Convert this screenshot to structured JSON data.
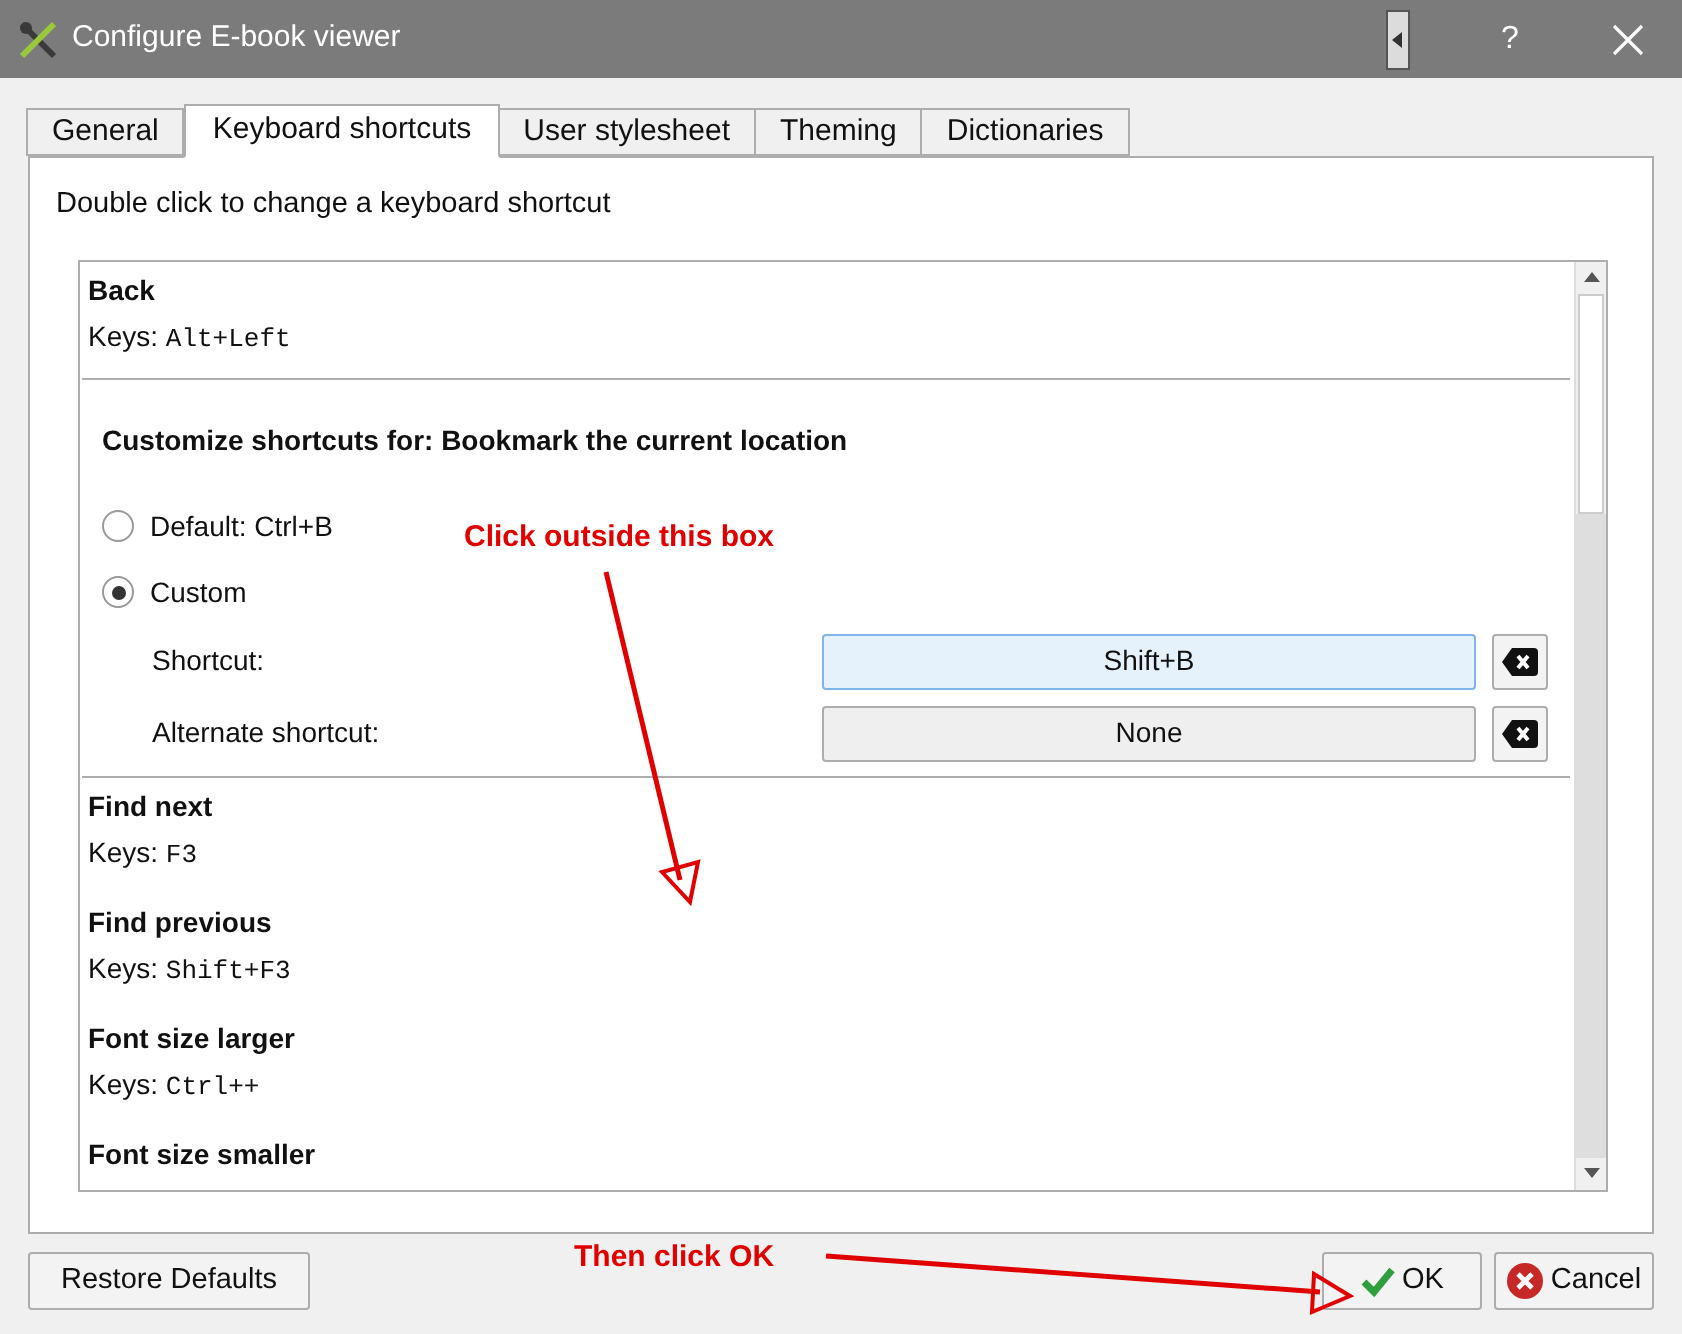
{
  "window": {
    "title": "Configure E-book viewer",
    "help": "?"
  },
  "tabs": [
    {
      "label": "General",
      "selected": false
    },
    {
      "label": "Keyboard shortcuts",
      "selected": true
    },
    {
      "label": "User stylesheet",
      "selected": false
    },
    {
      "label": "Theming",
      "selected": false
    },
    {
      "label": "Dictionaries",
      "selected": false
    }
  ],
  "hint": "Double click to change a keyboard shortcut",
  "shortcuts": [
    {
      "kind": "action",
      "name": "Back",
      "keys_label": "Keys:",
      "keys": "Alt+Left"
    },
    {
      "kind": "editor",
      "heading": "Customize shortcuts for: Bookmark the current location",
      "options": [
        {
          "label": "Default: Ctrl+B",
          "selected": false
        },
        {
          "label": "Custom",
          "selected": true
        }
      ],
      "fields": [
        {
          "label": "Shortcut:",
          "value": "Shift+B",
          "focused": true
        },
        {
          "label": "Alternate shortcut:",
          "value": "None",
          "focused": false
        }
      ]
    },
    {
      "kind": "action",
      "name": "Find next",
      "keys_label": "Keys:",
      "keys": "F3"
    },
    {
      "kind": "action",
      "name": "Find previous",
      "keys_label": "Keys:",
      "keys": "Shift+F3"
    },
    {
      "kind": "action",
      "name": "Font size larger",
      "keys_label": "Keys:",
      "keys": "Ctrl++"
    },
    {
      "kind": "action",
      "name": "Font size smaller"
    }
  ],
  "buttons": [
    {
      "kind": "restore",
      "label": "Restore Defaults"
    },
    {
      "kind": "ok",
      "label": "OK"
    },
    {
      "kind": "cancel",
      "label": "Cancel"
    }
  ],
  "annotations": [
    {
      "text": "Click outside this box"
    },
    {
      "text": "Then click OK"
    }
  ]
}
